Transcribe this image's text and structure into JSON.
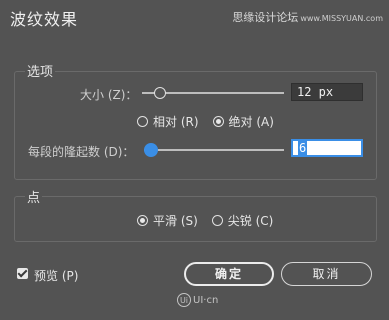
{
  "dialog": {
    "title": "波纹效果",
    "watermark_main": "思缘设计论坛",
    "watermark_url": "www.MISSYUAN.com"
  },
  "options_group": {
    "label": "选项",
    "size": {
      "label": "大小 (Z)：",
      "value": "12 px",
      "slider_fraction": 0.12
    },
    "mode_radios": [
      {
        "label": "相对 (R)",
        "checked": false
      },
      {
        "label": "绝对 (A)",
        "checked": true
      }
    ],
    "ridges": {
      "label": "每段的隆起数 (D)：",
      "value": "6",
      "slider_fraction": 0.0
    }
  },
  "point_group": {
    "label": "点",
    "radios": [
      {
        "label": "平滑 (S)",
        "checked": true
      },
      {
        "label": "尖锐 (C)",
        "checked": false
      }
    ]
  },
  "footer": {
    "preview_label": "预览 (P)",
    "preview_checked": true,
    "ok_label": "确定",
    "cancel_label": "取消",
    "logo_text": "UI·cn",
    "logo_badge": "Ui"
  },
  "colors": {
    "background": "#535353",
    "accent": "#3a8ee6",
    "text": "#e6e6e6"
  }
}
